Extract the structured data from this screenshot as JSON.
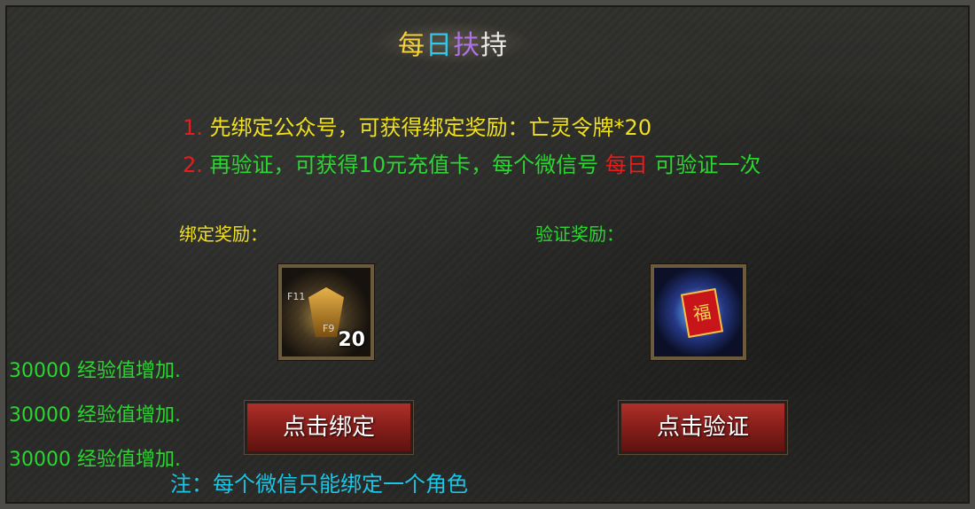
{
  "title": {
    "ch1": "每",
    "ch2": "日",
    "ch3": "扶",
    "ch4": "持"
  },
  "notes": [
    {
      "num": "1.",
      "text": "先绑定公众号，可获得绑定奖励：亡灵令牌*20"
    },
    {
      "num": "2.",
      "text_a": "再验证，可获得10元充值卡，每个微信号",
      "highlight": "每日",
      "text_b": "可验证一次"
    }
  ],
  "bind_reward": {
    "label": "绑定奖励：",
    "item_name_icon": "undead-token-icon",
    "hotkey_a": "F11",
    "hotkey_b": "F9",
    "count": "20",
    "button": "点击绑定"
  },
  "verify_reward": {
    "label": "验证奖励：",
    "item_name_icon": "red-envelope-card-icon",
    "icon_glyph": "福",
    "button": "点击验证"
  },
  "exp_messages": [
    "30000 经验值增加.",
    "30000 经验值增加.",
    "30000 经验值增加."
  ],
  "footer_note": "注：每个微信只能绑定一个角色",
  "colors": {
    "title_1": "#f5d23a",
    "title_2": "#33c8e6",
    "title_3": "#b070e8",
    "title_4": "#e8e8e8",
    "num": "#e81c1c",
    "note1": "#f0e020",
    "note2": "#2bd631",
    "highlight": "#e81c1c",
    "bind_label": "#f0e020",
    "verify_label": "#2bd631",
    "exp": "#2bd631",
    "footer": "#19c6e6"
  }
}
